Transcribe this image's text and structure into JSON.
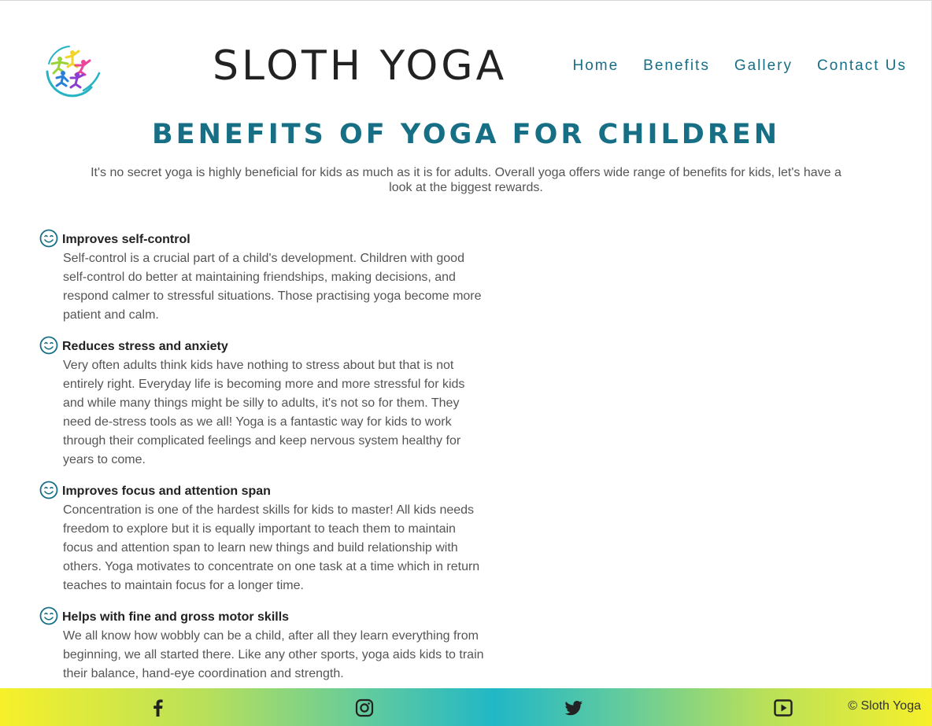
{
  "header": {
    "brand": "SLOTH YOGA",
    "nav": [
      {
        "label": "Home"
      },
      {
        "label": "Benefits"
      },
      {
        "label": "Gallery"
      },
      {
        "label": "Contact Us"
      }
    ]
  },
  "main": {
    "title": "BENEFITS OF YOGA FOR CHILDREN",
    "intro": "It's no secret yoga is highly beneficial for kids as much as it is for adults. Overall yoga offers wide range of benefits for kids, let's have a look at the biggest rewards.",
    "benefits": [
      {
        "icon": "smile-icon",
        "title": "Improves self-control",
        "text": "Self-control is a crucial part of a child's development. Children with good self-control do better at maintaining friendships, making decisions, and respond calmer to stressful situations. Those practising yoga become more patient and calm."
      },
      {
        "icon": "smile-icon",
        "title": "Reduces stress and anxiety",
        "text": "Very often adults think kids have nothing to stress about but that is not entirely right. Everyday life is becoming more and more stressful for kids and while many things might be silly to adults, it's not so for them. They need de-stress tools as we all! Yoga is a fantastic way for kids to work through their complicated feelings and keep nervous system healthy for years to come."
      },
      {
        "icon": "smile-icon",
        "title": "Improves focus and attention span",
        "text": "Concentration is one of the hardest skills for kids to master! All kids needs freedom to explore but it is equally important to teach them to maintain focus and attention span to learn new things and build relationship with others. Yoga motivates to concentrate on one task at a time which in return teaches to maintain focus for a longer time."
      },
      {
        "icon": "smile-icon",
        "title": "Helps with fine and gross motor skills",
        "text": "We all know how wobbly can be a child, after all they learn everything from beginning, we all started there. Like any other sports, yoga aids kids to train their balance, hand-eye coordination and strength."
      }
    ]
  },
  "footer": {
    "social": [
      {
        "icon": "facebook-icon"
      },
      {
        "icon": "instagram-icon"
      },
      {
        "icon": "twitter-icon"
      },
      {
        "icon": "youtube-icon"
      }
    ],
    "copyright": "© Sloth Yoga"
  },
  "colors": {
    "accent": "#176f86",
    "gradient_edge": "#f7f02a",
    "gradient_center": "#21b7c6"
  }
}
